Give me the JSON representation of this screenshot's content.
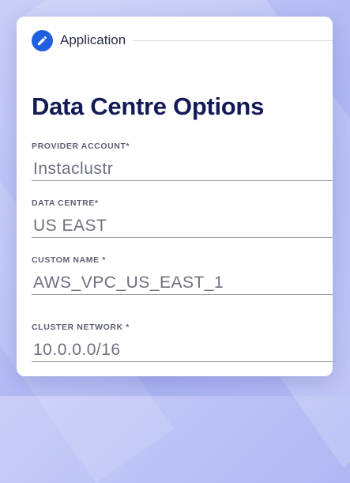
{
  "header": {
    "title": "Application",
    "icon": "edit-pencil-icon",
    "accent_color": "#1f5fe0"
  },
  "page": {
    "title": "Data Centre Options"
  },
  "fields": [
    {
      "label": "PROVIDER ACCOUNT*",
      "value": "Instaclustr"
    },
    {
      "label": "DATA CENTRE*",
      "value": "US EAST"
    },
    {
      "label": "CUSTOM NAME *",
      "value": "AWS_VPC_US_EAST_1"
    },
    {
      "label": "CLUSTER NETWORK *",
      "value": "10.0.0.0/16"
    }
  ]
}
